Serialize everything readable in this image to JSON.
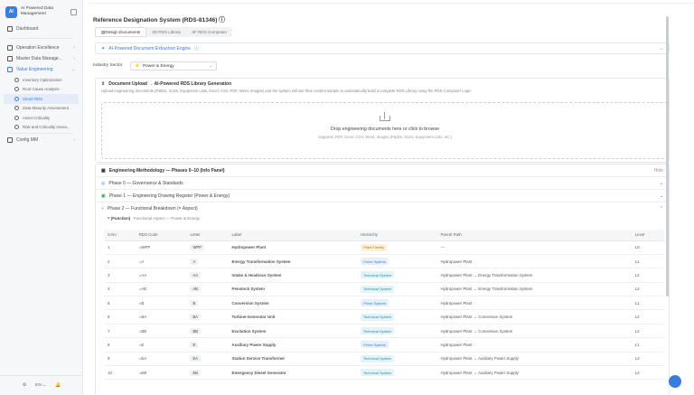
{
  "app": {
    "logo": "AI",
    "title": "AI Powered Data Management"
  },
  "sidebar": {
    "items": [
      {
        "label": "Dashboard",
        "type": "item"
      },
      {
        "label": "Operation Excellence",
        "type": "item"
      },
      {
        "label": "Master Data Manage...",
        "type": "item"
      },
      {
        "label": "Value Engineering",
        "type": "open"
      },
      {
        "label": "Inventory Optimization",
        "type": "sub"
      },
      {
        "label": "Root Cause Analysis",
        "type": "sub"
      },
      {
        "label": "Smart RDS",
        "type": "sub-active"
      },
      {
        "label": "Data Maturity Assessment",
        "type": "sub"
      },
      {
        "label": "Asset Criticality",
        "type": "sub"
      },
      {
        "label": "Risk and Criticality Asses...",
        "type": "sub"
      },
      {
        "label": "Config MM",
        "type": "item"
      }
    ],
    "footer": {
      "lang": "EN",
      "lang_chevron": "⌄"
    }
  },
  "page": {
    "title": "Reference Designation System (RDS-81346)",
    "tabs": [
      "Design Documents",
      "3D RDS Library",
      "3F RDS Composer"
    ]
  },
  "extraction_panel": {
    "title": "AI-Powered Document Extraction Engine"
  },
  "industry": {
    "label": "Industry Sector",
    "value": "Power & Energy"
  },
  "upload": {
    "title": "Document Upload → AI-Powered RDS Library Generation",
    "description": "Upload engineering documents (P&IDs, SLDs, Equipment Lists, Excel, CSV, PDF, Word, Images) and the system will use their content sample to automatically build a complete RDS Library using the RDS Composer Logic.",
    "drop_title": "Drop engineering documents here or click to browse",
    "drop_sub": "Supports: PDF, Excel, CSV, Word, Images (P&IDs, SLDs, Equipment Lists, etc.)"
  },
  "methodology": {
    "title": "Engineering Methodology — Phases 0–10 (Info Panel)",
    "toggle": "Hide",
    "phases": [
      "Phase 0 — Governance & Standards",
      "Phase 1 — Engineering Drawing Register (Power & Energy)",
      "Phase 2 — Functional Breakdown (= Aspect)"
    ],
    "breadcrumb_a": "= (Function)",
    "breadcrumb_b": "Functional Aspect — Power & Energy"
  },
  "table": {
    "headers": [
      "S.No",
      "RDS Code",
      "Letter",
      "Label",
      "Hierarchy",
      "Parent Path",
      "Level"
    ],
    "rows": [
      {
        "sno": "1",
        "code": "=WPP",
        "letter": "WPP",
        "label": "Hydropower Plant",
        "hier": "Plant Facility",
        "htype": "plant",
        "parent": "—",
        "level": "L0"
      },
      {
        "sno": "2",
        "code": "=A",
        "letter": "A",
        "label": "Energy Transformation System",
        "hier": "Prime System",
        "htype": "prime",
        "parent": "Hydropower Plant",
        "level": "L1"
      },
      {
        "sno": "3",
        "code": "=AA",
        "letter": "AA",
        "label": "Intake & Headrace System",
        "hier": "Technical System",
        "htype": "tech",
        "parent": "Hydropower Plant → Energy Transformation System",
        "level": "L2"
      },
      {
        "sno": "4",
        "code": "=AB",
        "letter": "AB",
        "label": "Penstock System",
        "hier": "Technical System",
        "htype": "tech",
        "parent": "Hydropower Plant → Energy Transformation System",
        "level": "L2"
      },
      {
        "sno": "5",
        "code": "=B",
        "letter": "B",
        "label": "Conversion System",
        "hier": "Prime System",
        "htype": "prime",
        "parent": "Hydropower Plant",
        "level": "L1"
      },
      {
        "sno": "6",
        "code": "=BA",
        "letter": "BA",
        "label": "Turbine-Generator Unit",
        "hier": "Technical System",
        "htype": "tech",
        "parent": "Hydropower Plant → Conversion System",
        "level": "L2"
      },
      {
        "sno": "7",
        "code": "=BB",
        "letter": "BB",
        "label": "Excitation System",
        "hier": "Technical System",
        "htype": "tech",
        "parent": "Hydropower Plant → Conversion System",
        "level": "L2"
      },
      {
        "sno": "8",
        "code": "=E",
        "letter": "E",
        "label": "Auxiliary Power Supply",
        "hier": "Prime System",
        "htype": "prime",
        "parent": "Hydropower Plant",
        "level": "L1"
      },
      {
        "sno": "9",
        "code": "=EA",
        "letter": "EA",
        "label": "Station Service Transformer",
        "hier": "Technical System",
        "htype": "tech",
        "parent": "Hydropower Plant → Auxiliary Power Supply",
        "level": "L2"
      },
      {
        "sno": "10",
        "code": "=EB",
        "letter": "EB",
        "label": "Emergency Diesel Generator",
        "hier": "Technical System",
        "htype": "tech",
        "parent": "Hydropower Plant → Auxiliary Power Supply",
        "level": "L2"
      }
    ]
  },
  "colors": {
    "accent": "#3b7ddd",
    "plant": "#fdf0d7",
    "prime": "#e5f0ff",
    "tech": "#e2f4f7"
  }
}
